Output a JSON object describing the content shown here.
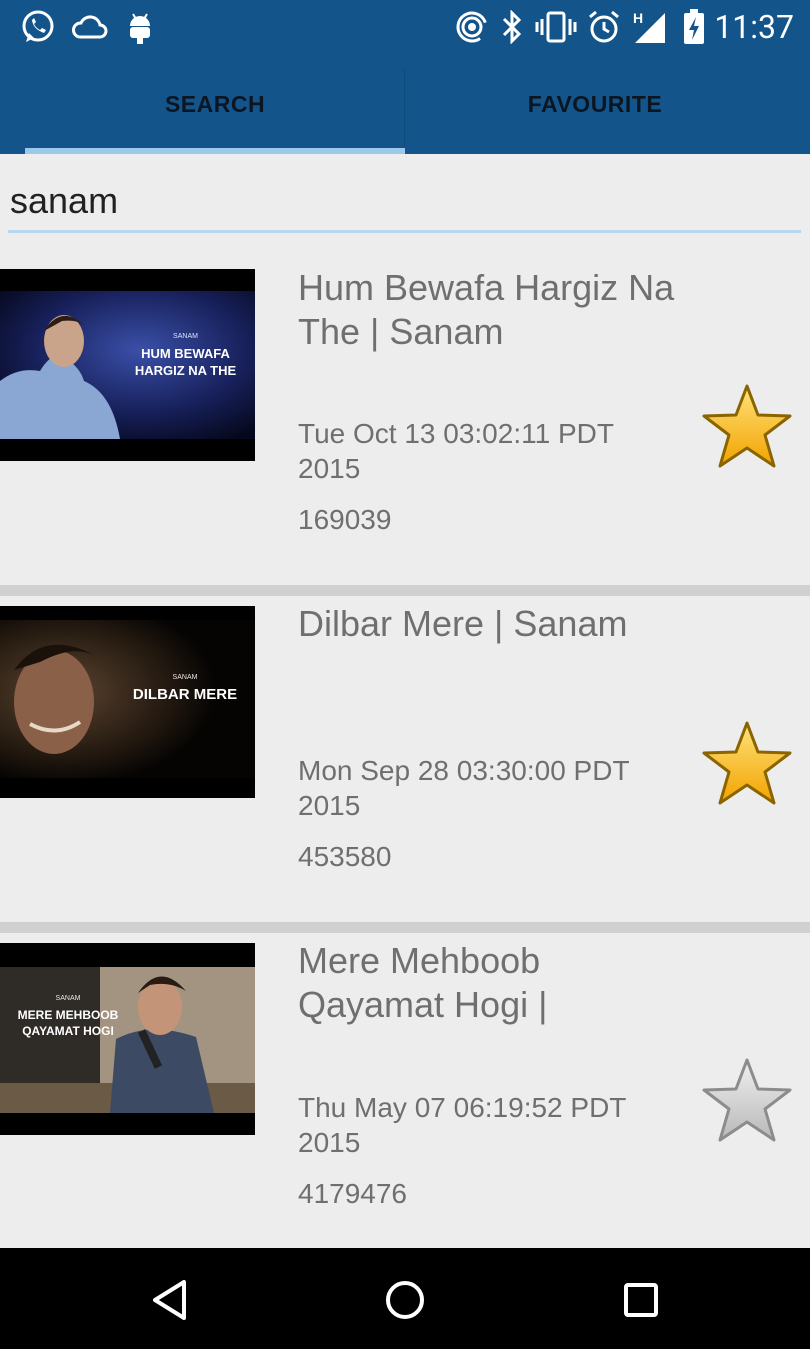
{
  "status_bar": {
    "time": "11:37",
    "left_icons": [
      "whatsapp-icon",
      "cloud-icon",
      "android-icon"
    ],
    "right_icons": [
      "hotspot-icon",
      "bluetooth-icon",
      "vibrate-icon",
      "alarm-icon",
      "signal-h-icon",
      "battery-charging-icon"
    ]
  },
  "tabs": [
    {
      "label": "SEARCH",
      "selected": true
    },
    {
      "label": "FAVOURITE",
      "selected": false
    }
  ],
  "search": {
    "value": "sanam"
  },
  "results": [
    {
      "title": "Hum Bewafa Hargiz Na The | Sanam",
      "date": "Tue Oct 13 03:02:11 PDT 2015",
      "views": "169039",
      "favourite": true,
      "thumb": {
        "small": "SANAM",
        "big": "HUM BEWAFA\nHARGIZ NA THE"
      }
    },
    {
      "title": "Dilbar Mere | Sanam",
      "date": "Mon Sep 28 03:30:00 PDT 2015",
      "views": "453580",
      "favourite": true,
      "thumb": {
        "small": "SANAM",
        "big": "DILBAR MERE"
      }
    },
    {
      "title": "Mere Mehboob Qayamat Hogi |",
      "date": "Thu May 07 06:19:52 PDT 2015",
      "views": "4179476",
      "favourite": false,
      "thumb": {
        "small": "SANAM",
        "big": "MERE MEHBOOB\nQAYAMAT HOGI"
      }
    }
  ],
  "colors": {
    "primary": "#13558b",
    "indicator": "#9cc8ea",
    "star_on": "#f4b400",
    "star_off": "#bdbdbd"
  },
  "nav_bar": [
    "back-icon",
    "home-icon",
    "recents-icon"
  ]
}
